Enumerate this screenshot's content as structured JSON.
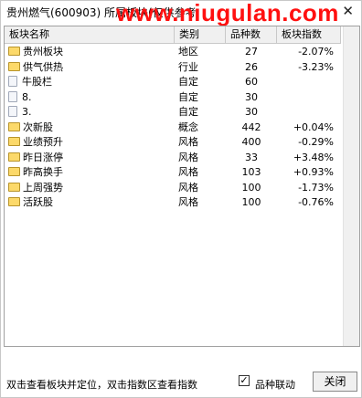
{
  "window": {
    "title": "贵州燃气(600903)  所属板块(仅供参考",
    "watermark": "www.niugulan.com",
    "close_glyph": "✕"
  },
  "columns": {
    "name": "板块名称",
    "type": "类别",
    "count": "品种数",
    "index": "板块指数"
  },
  "rows": [
    {
      "icon": "folder-icon",
      "name": "贵州板块",
      "type": "地区",
      "count": "27",
      "index": "-2.07%"
    },
    {
      "icon": "folder-icon",
      "name": "供气供热",
      "type": "行业",
      "count": "26",
      "index": "-3.23%"
    },
    {
      "icon": "file-icon",
      "name": "牛股栏",
      "type": "自定",
      "count": "60",
      "index": ""
    },
    {
      "icon": "file-icon",
      "name": "8.",
      "type": "自定",
      "count": "30",
      "index": ""
    },
    {
      "icon": "file-icon",
      "name": "3.",
      "type": "自定",
      "count": "30",
      "index": ""
    },
    {
      "icon": "folder-icon",
      "name": "次新股",
      "type": "概念",
      "count": "442",
      "index": "+0.04%"
    },
    {
      "icon": "folder-icon",
      "name": "业绩预升",
      "type": "风格",
      "count": "400",
      "index": "-0.29%"
    },
    {
      "icon": "folder-icon",
      "name": "昨日涨停",
      "type": "风格",
      "count": "33",
      "index": "+3.48%"
    },
    {
      "icon": "folder-icon",
      "name": "昨高换手",
      "type": "风格",
      "count": "103",
      "index": "+0.93%"
    },
    {
      "icon": "folder-icon",
      "name": "上周强势",
      "type": "风格",
      "count": "100",
      "index": "-1.73%"
    },
    {
      "icon": "folder-icon",
      "name": "活跃股",
      "type": "风格",
      "count": "100",
      "index": "-0.76%"
    }
  ],
  "footer": {
    "hint": "双击查看板块并定位，双击指数区查看指数",
    "checkbox_label": "品种联动",
    "checkbox_checked": true,
    "check_glyph": "✓",
    "close_label": "关闭"
  }
}
